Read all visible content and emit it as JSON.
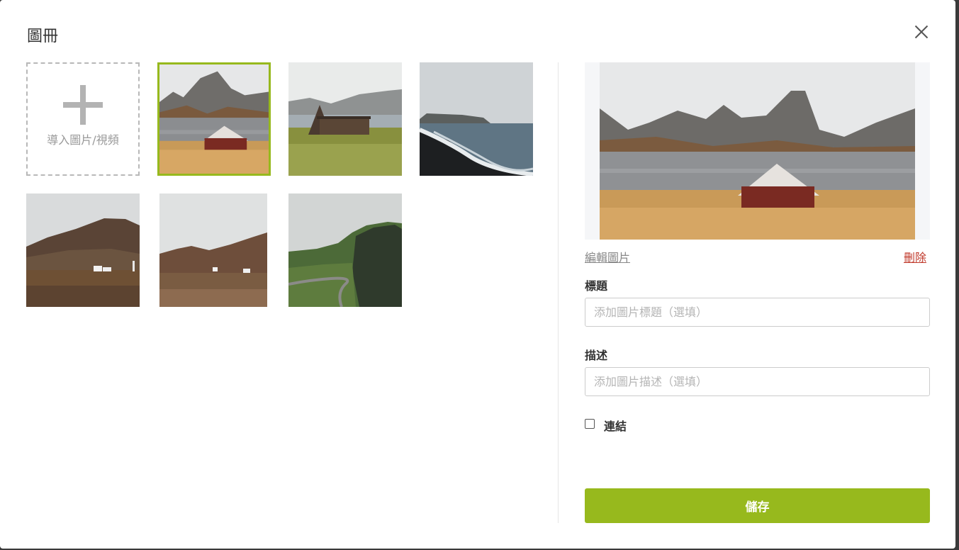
{
  "dialog": {
    "title": "圖冊"
  },
  "gallery": {
    "upload_label": "導入圖片/視頻",
    "selected_index": 0,
    "accent_color": "#97b91d"
  },
  "details": {
    "edit_link": "編輯圖片",
    "delete_link": "刪除",
    "title_label": "標題",
    "title_placeholder": "添加圖片標題（選填）",
    "title_value": "",
    "description_label": "描述",
    "description_placeholder": "添加圖片描述（選填）",
    "description_value": "",
    "link_label": "連結",
    "link_checked": false,
    "save_label": "儲存"
  },
  "icons": {
    "close": "close-icon",
    "upload": "plus-icon"
  }
}
